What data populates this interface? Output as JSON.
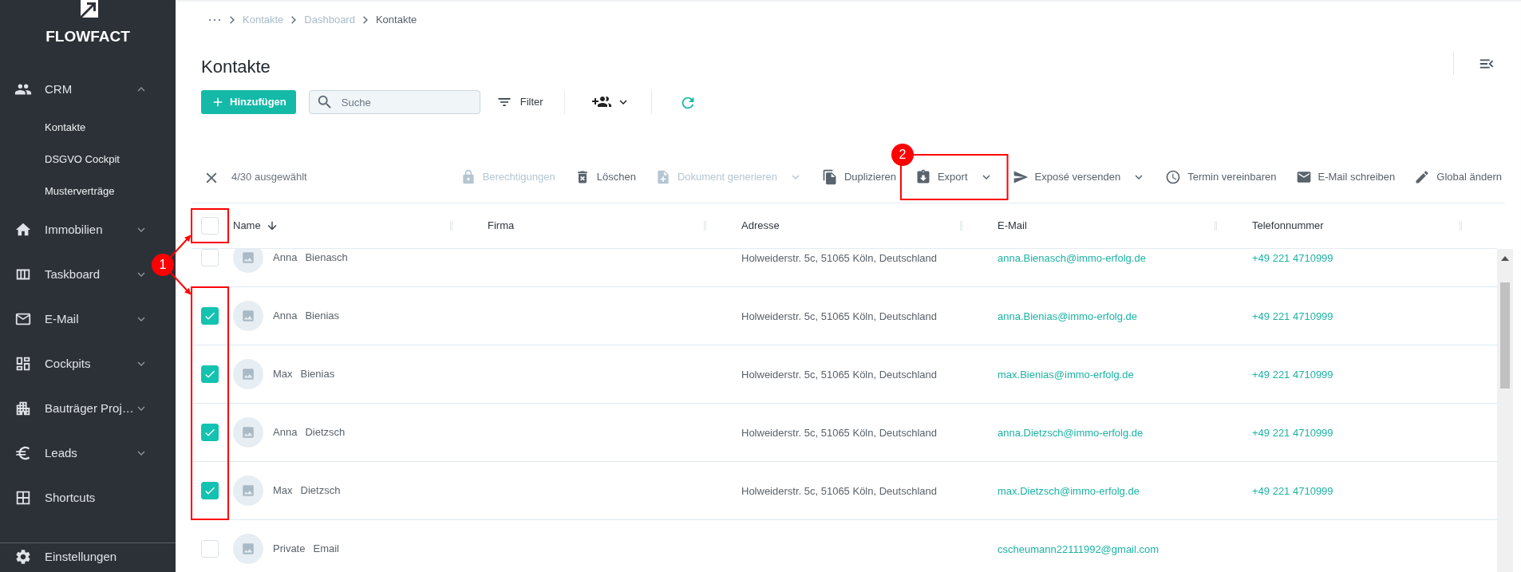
{
  "sidebar": {
    "logo": "FLOWFACT",
    "items": [
      {
        "label": "CRM",
        "kind": "group",
        "expanded": true,
        "children": [
          {
            "label": "Kontakte"
          },
          {
            "label": "DSGVO Cockpit"
          },
          {
            "label": "Musterverträge"
          }
        ]
      },
      {
        "label": "Immobilien",
        "kind": "group",
        "expanded": false
      },
      {
        "label": "Taskboard",
        "kind": "group",
        "expanded": false
      },
      {
        "label": "E-Mail",
        "kind": "group",
        "expanded": false
      },
      {
        "label": "Cockpits",
        "kind": "group",
        "expanded": false
      },
      {
        "label": "Bauträger Proj…",
        "kind": "group",
        "expanded": false
      },
      {
        "label": "Leads",
        "kind": "group",
        "expanded": false
      },
      {
        "label": "Shortcuts",
        "kind": "link"
      }
    ],
    "footer_item": {
      "label": "Einstellungen"
    }
  },
  "breadcrumb": [
    {
      "label": "Kontakte",
      "current": false
    },
    {
      "label": "Dashboard",
      "current": false
    },
    {
      "label": "Kontakte",
      "current": true
    }
  ],
  "page_title": "Kontakte",
  "toolbar": {
    "add_button": "Hinzufügen",
    "search": {
      "placeholder": "Suche"
    },
    "filter_button": "Filter"
  },
  "selection_bar": {
    "count": "4/30 ausgewählt",
    "actions": [
      {
        "label": "Berechtigungen",
        "kind": "button",
        "disabled": true
      },
      {
        "label": "Löschen",
        "kind": "button",
        "disabled": false
      },
      {
        "label": "Dokument generieren",
        "kind": "menu",
        "disabled": true
      },
      {
        "label": "Duplizieren",
        "kind": "button",
        "disabled": false
      },
      {
        "label": "Export",
        "kind": "menu",
        "disabled": false
      },
      {
        "label": "Exposé versenden",
        "kind": "menu",
        "disabled": false
      },
      {
        "label": "Termin vereinbaren",
        "kind": "button",
        "disabled": false
      },
      {
        "label": "E-Mail schreiben",
        "kind": "button",
        "disabled": false
      },
      {
        "label": "Global ändern",
        "kind": "button",
        "disabled": false
      }
    ]
  },
  "table": {
    "select_all": {
      "checked": false
    },
    "columns": [
      {
        "label": "Name",
        "sorted_descending": true
      },
      {
        "label": "Firma"
      },
      {
        "label": "Adresse"
      },
      {
        "label": "E-Mail"
      },
      {
        "label": "Telefonnummer"
      }
    ],
    "rows": [
      {
        "selected": false,
        "first_name": "Anna",
        "last_name": "Bienasch",
        "address": "Holweiderstr. 5c, 51065 Köln, Deutschland",
        "email": "anna.Bienasch@immo-erfolg.de",
        "phone": "+49 221 4710999"
      },
      {
        "selected": true,
        "first_name": "Anna",
        "last_name": "Bienias",
        "address": "Holweiderstr. 5c, 51065 Köln, Deutschland",
        "email": "anna.Bienias@immo-erfolg.de",
        "phone": "+49 221 4710999"
      },
      {
        "selected": true,
        "first_name": "Max",
        "last_name": "Bienias",
        "address": "Holweiderstr. 5c, 51065 Köln, Deutschland",
        "email": "max.Bienias@immo-erfolg.de",
        "phone": "+49 221 4710999"
      },
      {
        "selected": true,
        "first_name": "Anna",
        "last_name": "Dietzsch",
        "address": "Holweiderstr. 5c, 51065 Köln, Deutschland",
        "email": "anna.Dietzsch@immo-erfolg.de",
        "phone": "+49 221 4710999"
      },
      {
        "selected": true,
        "first_name": "Max",
        "last_name": "Dietzsch",
        "address": "Holweiderstr. 5c, 51065 Köln, Deutschland",
        "email": "max.Dietzsch@immo-erfolg.de",
        "phone": "+49 221 4710999"
      },
      {
        "selected": false,
        "first_name": "Private",
        "last_name": "Email",
        "email": "cscheumann22111992@gmail.com"
      }
    ]
  },
  "annotations": [
    {
      "number": "1"
    },
    {
      "number": "2"
    }
  ]
}
